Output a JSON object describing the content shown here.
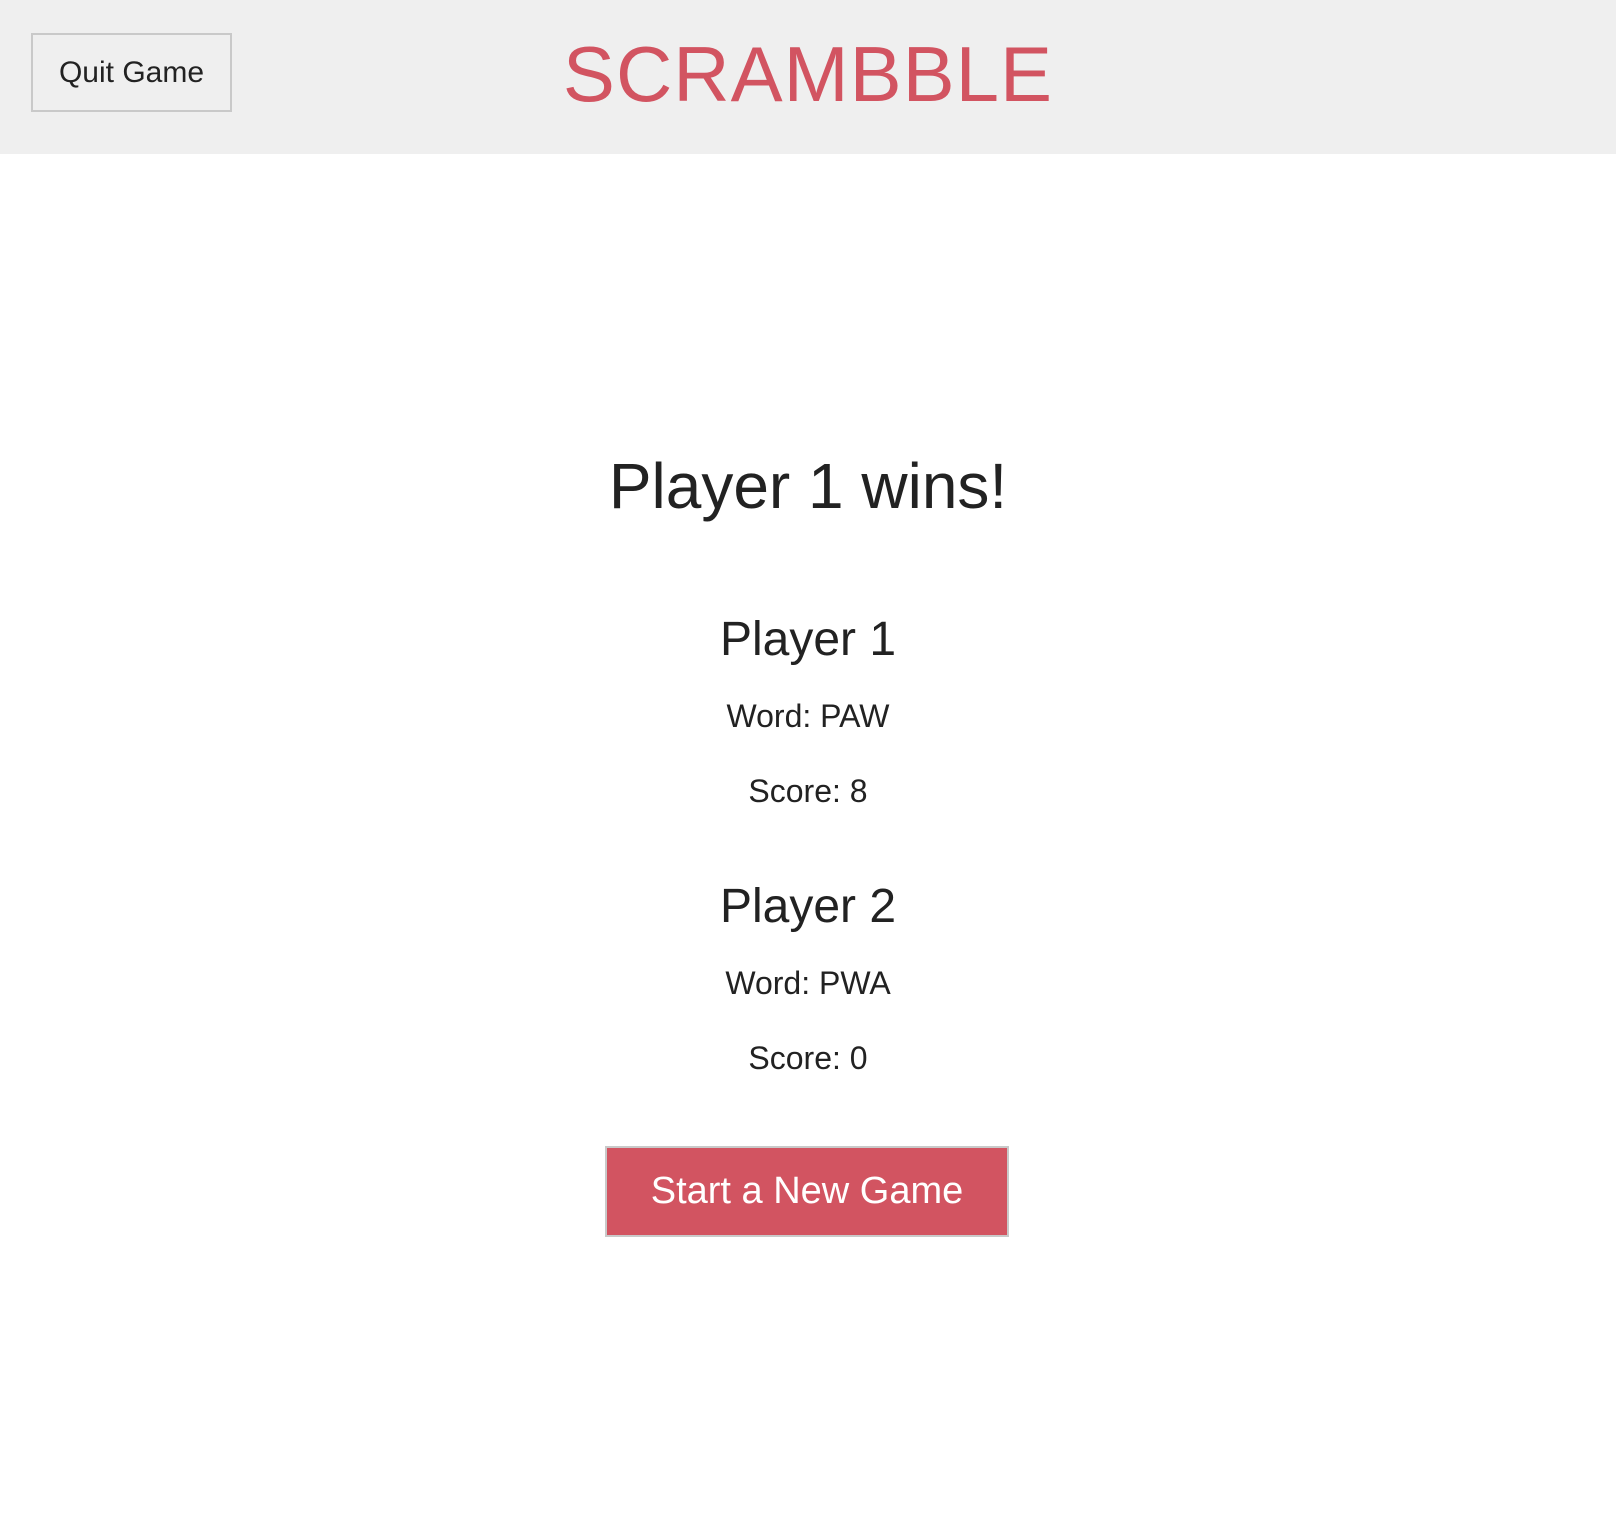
{
  "header": {
    "quit_label": "Quit Game",
    "title": "SCRAMBBLE"
  },
  "result": {
    "heading": "Player 1 wins!"
  },
  "players": [
    {
      "name": "Player 1",
      "word_text": "Word: PAW",
      "score_text": "Score: 8"
    },
    {
      "name": "Player 2",
      "word_text": "Word: PWA",
      "score_text": "Score: 0"
    }
  ],
  "actions": {
    "new_game_label": "Start a New Game"
  },
  "colors": {
    "accent": "#d25461",
    "header_bg": "#efefef",
    "text": "#222222"
  }
}
